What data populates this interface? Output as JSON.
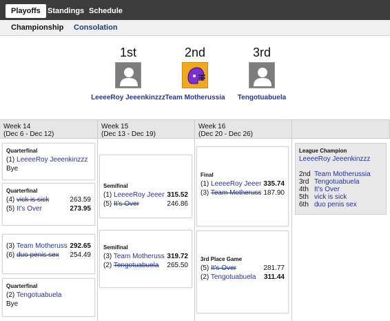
{
  "topnav": {
    "tabs": [
      {
        "label": "Playoffs",
        "active": true
      },
      {
        "label": "Standings",
        "active": false
      },
      {
        "label": "Schedule",
        "active": false
      }
    ]
  },
  "subnav": {
    "championship": "Championship",
    "consolation": "Consolation"
  },
  "podium": [
    {
      "place": "1st",
      "team": "LeeeeRoy Jeeenkinzzz",
      "avatar": "person-icon"
    },
    {
      "place": "2nd",
      "team": "Team Motherussia",
      "avatar": "helmet-icon"
    },
    {
      "place": "3rd",
      "team": "Tengotuabuela",
      "avatar": "person-icon"
    }
  ],
  "weeks": [
    {
      "label": "Week 14",
      "dates": "(Dec 6 - Dec 12)"
    },
    {
      "label": "Week 15",
      "dates": "(Dec 13 - Dec 19)"
    },
    {
      "label": "Week 16",
      "dates": "(Dec 20 - Dec 26)"
    }
  ],
  "week14": {
    "qf1": {
      "title": "Quarterfinal",
      "seed": "(1)",
      "team": "LeeeeRoy Jeeenkinzzz",
      "bye": "Bye"
    },
    "qf2": {
      "title": "Quarterfinal",
      "a": {
        "seed": "(4)",
        "team": "vick is sick",
        "score": "263.59"
      },
      "b": {
        "seed": "(5)",
        "team": "It's Over",
        "score": "273.95"
      }
    },
    "qf3": {
      "title": "Quarterfinal",
      "a": {
        "seed": "(3)",
        "team": "Team Motherussia",
        "score": "292.65"
      },
      "b": {
        "seed": "(6)",
        "team": "duo penis sex",
        "score": "254.49"
      }
    },
    "qf4": {
      "title": "Quarterfinal",
      "seed": "(2)",
      "team": "Tengotuabuela",
      "bye": "Bye"
    }
  },
  "week15": {
    "sf1": {
      "title": "Semifinal",
      "a": {
        "seed": "(1)",
        "team": "LeeeeRoy Jeeenkinzzz",
        "score": "315.52"
      },
      "b": {
        "seed": "(5)",
        "team": "It's Over",
        "score": "246.86"
      }
    },
    "sf2": {
      "title": "Semifinal",
      "a": {
        "seed": "(3)",
        "team": "Team Motherussia",
        "score": "319.72"
      },
      "b": {
        "seed": "(2)",
        "team": "Tengotuabuela",
        "score": "265.50"
      }
    }
  },
  "week16": {
    "final": {
      "title": "Final",
      "a": {
        "seed": "(1)",
        "team": "LeeeeRoy Jeeenkinzzz",
        "score": "335.74"
      },
      "b": {
        "seed": "(3)",
        "team": "Team Motherussia",
        "score": "187.90"
      }
    },
    "third": {
      "title": "3rd Place Game",
      "a": {
        "seed": "(5)",
        "team": "It's Over",
        "score": "281.77"
      },
      "b": {
        "seed": "(2)",
        "team": "Tengotuabuela",
        "score": "311.44"
      }
    }
  },
  "champion": {
    "title": "League Champion",
    "name": "LeeeeRoy Jeeenkinzzz",
    "ranks": [
      {
        "place": "2nd",
        "team": "Team Motherussia"
      },
      {
        "place": "3rd",
        "team": "Tengotuabuela"
      },
      {
        "place": "4th",
        "team": "It's Over"
      },
      {
        "place": "5th",
        "team": "vick is sick"
      },
      {
        "place": "6th",
        "team": "duo penis sex"
      }
    ]
  }
}
